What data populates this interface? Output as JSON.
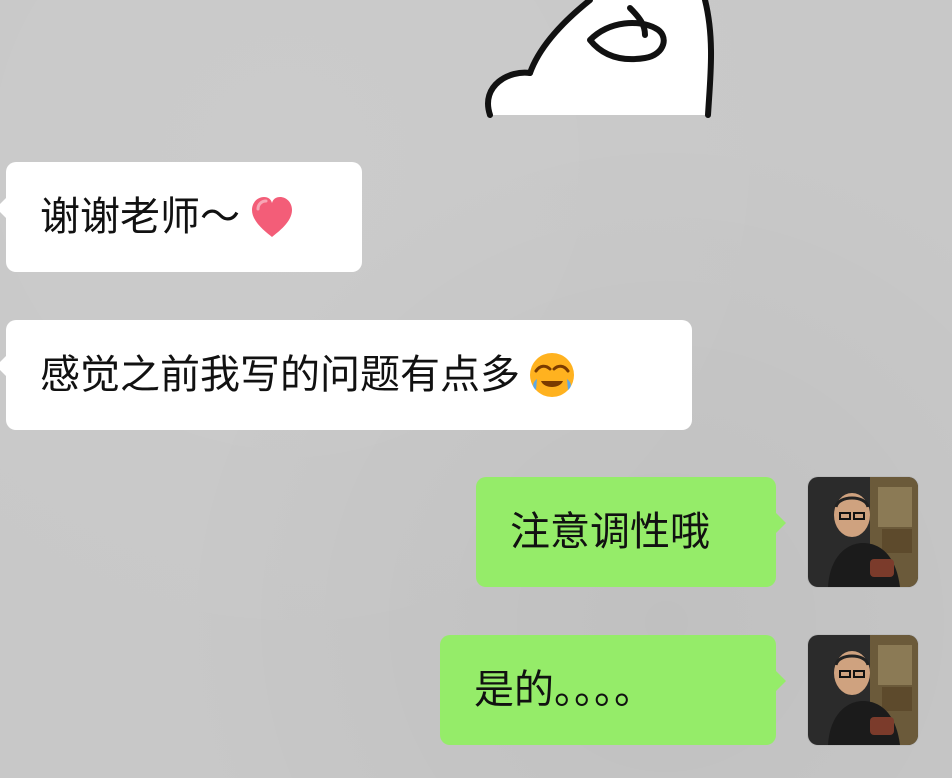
{
  "chat": {
    "sticker": {
      "icon": "hand-drawn-character-sticker"
    },
    "messages": [
      {
        "side": "incoming",
        "text": "谢谢老师～",
        "emoji": "red-heart-icon"
      },
      {
        "side": "incoming",
        "text": "感觉之前我写的问题有点多",
        "emoji": "crying-face-emoji-icon"
      },
      {
        "side": "outgoing",
        "text": "注意调性哦",
        "avatar": "teacher-avatar"
      },
      {
        "side": "outgoing",
        "text": "是的。。。。",
        "avatar": "teacher-avatar"
      }
    ]
  },
  "colors": {
    "background": "#c8c8c8",
    "incoming_bubble": "#ffffff",
    "outgoing_bubble": "#95ec69",
    "text": "#111111",
    "heart": "#f35d78",
    "emoji_face": "#ffb21f"
  }
}
